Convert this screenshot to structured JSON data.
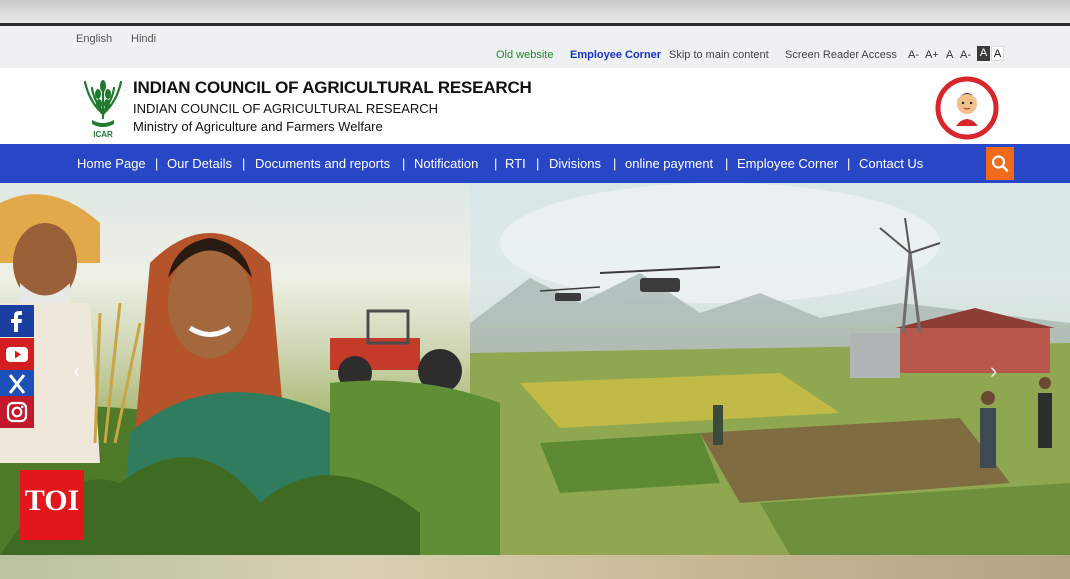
{
  "topbar": {
    "languages": [
      "English",
      "Hindi"
    ],
    "links": {
      "old_website": "Old website",
      "employee_corner": "Employee Corner",
      "skip": "Skip to main content",
      "screen_reader": "Screen Reader Access"
    },
    "font_sizes": [
      "A-",
      "A+",
      "A",
      "A-"
    ],
    "contrast": [
      "A",
      "A"
    ]
  },
  "header": {
    "title": "INDIAN COUNCIL OF AGRICULTURAL RESEARCH",
    "subtitle": "INDIAN COUNCIL OF AGRICULTURAL RESEARCH",
    "ministry": "Ministry of Agriculture and Farmers Welfare",
    "logo_text": "ICAR",
    "badge_icon": "beti-bachao-badge"
  },
  "nav": {
    "items": [
      "Home Page",
      "Our Details",
      "Documents and reports",
      "Notification",
      "RTI",
      "Divisions",
      "online payment",
      "Employee Corner",
      "Contact Us"
    ],
    "separator": "|",
    "search_icon": "search-icon"
  },
  "hero": {
    "prev": "‹",
    "next": "›"
  },
  "social": [
    {
      "icon": "facebook-icon",
      "glyph": "f",
      "color": "#1b3fa0"
    },
    {
      "icon": "youtube-icon",
      "glyph": "▶",
      "color": "#d21e1e"
    },
    {
      "icon": "x-icon",
      "glyph": "X",
      "color": "#1d4fb8"
    },
    {
      "icon": "instagram-icon",
      "glyph": "◎",
      "color": "#c2182b"
    }
  ],
  "watermark": "TOI",
  "colors": {
    "nav": "#2747c6",
    "search": "#f26a1b",
    "old_website": "#1f8a2a",
    "employee_corner": "#1733c7"
  }
}
